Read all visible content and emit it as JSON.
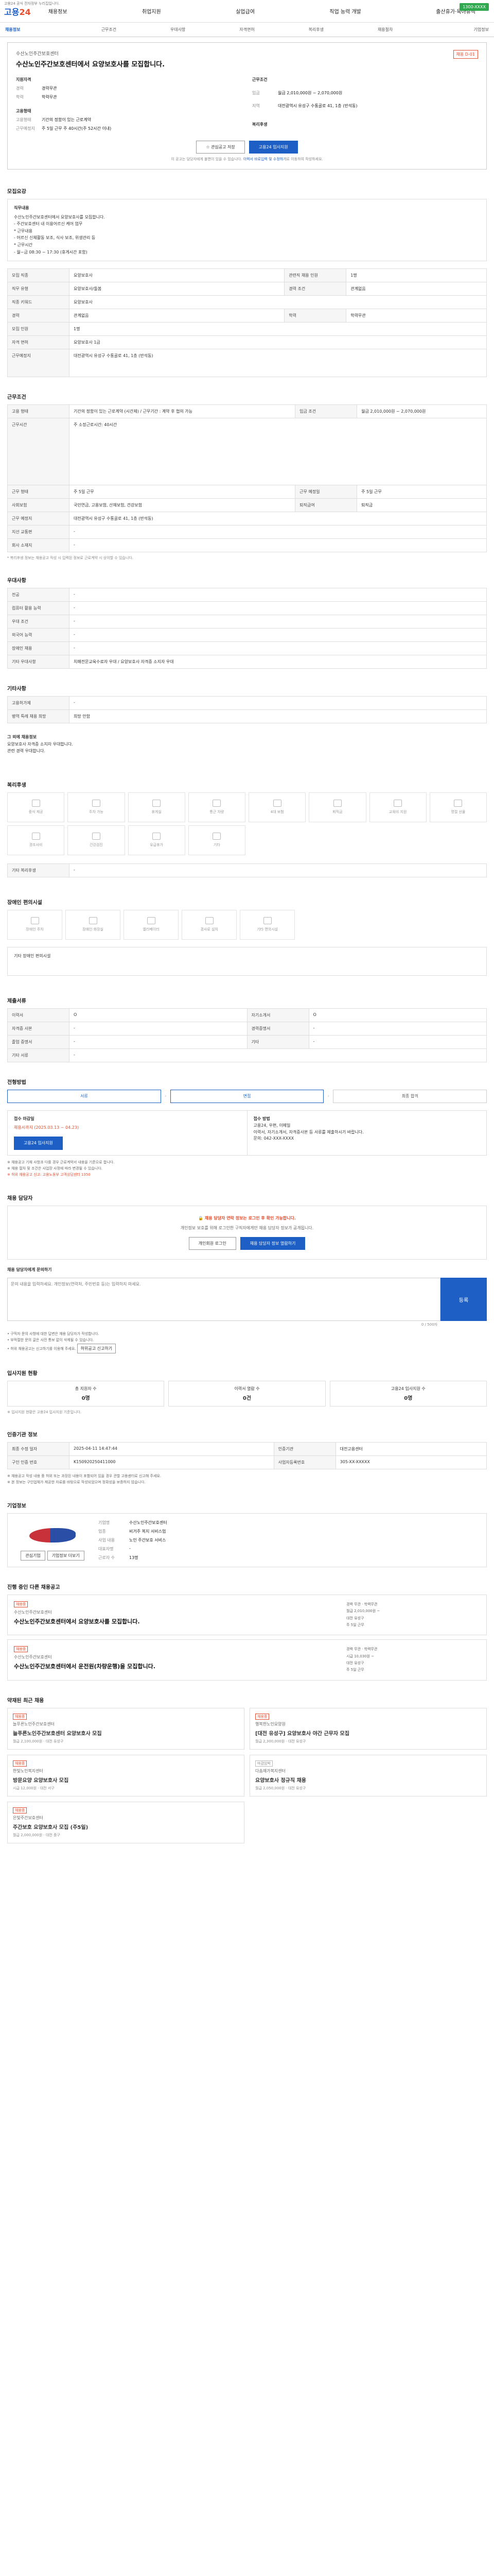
{
  "top": {
    "notice": "고용24 공식 전자정부 누리집입니다.",
    "logo_main": "고용",
    "logo_num": "24",
    "nav": [
      "채용정보",
      "취업지원",
      "실업급여",
      "직업 능력 개발",
      "출산휴가·육아휴직"
    ],
    "ad_btn": "1300-XXXX"
  },
  "tabs": [
    "채용정보",
    "근무조건",
    "우대사항",
    "자격면허",
    "복리후생",
    "채용절차",
    "기업정보"
  ],
  "head": {
    "org": "수산노인주간보호센터",
    "title": "수산노인주간보호센터에서 요양보호사를 모집합니다.",
    "badge": "채용 D-01",
    "left": [
      {
        "k": "지원자격",
        "v": ""
      },
      {
        "k": "경력",
        "v": "경력무관"
      },
      {
        "k": "학력",
        "v": "학력무관"
      },
      {
        "k": "고용형태",
        "v": ""
      },
      {
        "k": "고용형태",
        "v": "기간의 정함이 있는 근로계약"
      },
      {
        "k": "근무예정지",
        "v": "주 5일 근무 주 40시간(주 52시간 이내)"
      }
    ],
    "right": [
      {
        "k": "근무조건",
        "v": ""
      },
      {
        "k": "임금",
        "v": "월급 2,010,000원 ~ 2,070,000원"
      },
      {
        "k": "지역",
        "v": "대전광역시 유성구 수통골로 41, 1층 (반석동)"
      },
      {
        "k": "복리후생",
        "v": ""
      }
    ],
    "btn_scrap": "관심공고 저장",
    "btn_apply": "고용24 입사지원",
    "note_pre": "이 공고는 담당자에게 불편이 있을 수 있습니다.",
    "note_link": "이력서 바로입력 및 수정하기",
    "note_post": "로 이동하여 작성하세요."
  },
  "recruit": {
    "title": "모집요강",
    "job_label": "직무내용",
    "lines": [
      "수산노인주간보호센터에서 요양보호사를 모집합니다.",
      "- 주간보호센터 내 이용어르신 케어 업무",
      "* 근무내용",
      "- 어르신 신체활동 보조, 식사 보조, 위생관리 등",
      "* 근무시간",
      "- 월~금 08:30 ~ 17:30 (휴게시간 포함)"
    ],
    "rows": [
      {
        "k": "모집 직종",
        "v": "요양보호사",
        "k2": "관련직 채용 인원",
        "v2": "1명"
      },
      {
        "k": "직무 유형",
        "v": "요양보호사/돌봄",
        "k2": "경력 조건",
        "v2": "관계없음"
      },
      {
        "k": "직종 키워드",
        "v": "요양보호사",
        "k2": "",
        "v2": ""
      },
      {
        "k": "경력",
        "v": "관계없음",
        "k2": "학력",
        "v2": "학력무관"
      },
      {
        "k": "모집 인원",
        "v": "1명",
        "k2": "",
        "v2": ""
      },
      {
        "k": "자격 면허",
        "v": "요양보호사 1급",
        "k2": "",
        "v2": ""
      },
      {
        "k": "근무예정지",
        "v": "대전광역시 유성구 수통골로 41, 1층 (반석동)",
        "k2": "",
        "v2": ""
      }
    ]
  },
  "conditions": {
    "title": "근무조건",
    "rows": [
      {
        "k": "고용 형태",
        "v": "기간의 정함이 있는 근로계약 (시간제) / 근무기간 : 계약 후 협의 가능",
        "k2": "임금 조건",
        "v2": "월급 2,010,000원 ~ 2,070,000원"
      },
      {
        "k": "근무시간",
        "v": "주 소정근로시간: 40시간",
        "k2": "",
        "v2": ""
      },
      {
        "k": "근무 형태",
        "v": "주 5일 근무",
        "k2": "근무 예정일",
        "v2": "주 5일 근무"
      },
      {
        "k": "사회보험",
        "v": "국민연금, 고용보험, 산재보험, 건강보험",
        "k2": "퇴직급여",
        "v2": "퇴직금"
      },
      {
        "k": "근무 예정지",
        "v": "대전광역시 유성구 수통골로 41, 1층 (반석동)",
        "k2": "",
        "v2": ""
      },
      {
        "k": "지선 교통편",
        "v": "-",
        "k2": "",
        "v2": ""
      },
      {
        "k": "회사 소재지",
        "v": "-",
        "k2": "",
        "v2": ""
      }
    ],
    "note": "* 복리후생 정보는 채용공고 작성 시 입력된 정보로 근로계약 시 상이할 수 있습니다."
  },
  "prefer": {
    "title": "우대사항",
    "rows": [
      {
        "k": "전공",
        "v": "-"
      },
      {
        "k": "컴퓨터 활용 능력",
        "v": "-"
      },
      {
        "k": "우대 조건",
        "v": "-"
      },
      {
        "k": "외국어 능력",
        "v": "-"
      },
      {
        "k": "장애인 채용",
        "v": "-"
      },
      {
        "k": "기타 우대사항",
        "v": "치매전문교육수료자 우대 / 요양보호사 자격증 소지자 우대"
      }
    ]
  },
  "license": {
    "title": "기타사항",
    "rows": [
      {
        "k": "고용허가제",
        "v": "-"
      },
      {
        "k": "병역 특례 채용 희망",
        "v": "희망 안함"
      }
    ],
    "ext_title": "그 외에 채용정보",
    "ext_lines": [
      "요양보호사 자격증 소지자 우대합니다.",
      "관련 경력 우대합니다."
    ]
  },
  "welfare": {
    "title": "복리후생",
    "items": [
      "중식 제공",
      "주차 가능",
      "휴게실",
      "통근 차량",
      "4대 보험",
      "퇴직금",
      "교육비 지원",
      "명절 선물",
      "경조사비",
      "건강검진",
      "유급휴가",
      "기타"
    ],
    "extra_label": "기타 복리후생",
    "extra_value": "-"
  },
  "disab": {
    "title": "장애인 편의시설",
    "items": [
      "장애인 주차",
      "장애인 화장실",
      "엘리베이터",
      "경사로 설치",
      "기타 편의시설"
    ],
    "note": "기타 장애인 편의시설"
  },
  "docs": {
    "title": "제출서류",
    "rows": [
      {
        "k": "이력서",
        "v": "O",
        "k2": "자기소개서",
        "v2": "O"
      },
      {
        "k": "자격증 사본",
        "v": "-",
        "k2": "경력증명서",
        "v2": "-"
      },
      {
        "k": "졸업 증명서",
        "v": "-",
        "k2": "기타",
        "v2": "-"
      },
      {
        "k": "기타 서류",
        "v": "-",
        "k2": "",
        "v2": ""
      }
    ]
  },
  "procedure": {
    "title": "전형방법",
    "steps": [
      "서류",
      "면접",
      "최종 합격"
    ],
    "apply_title": "접수 마감일",
    "apply_date": "채용시까지 (2025.03.13 ~ 04.23)",
    "apply_btn": "고용24 입사지원",
    "method_title": "접수 방법",
    "method_lines": [
      "고용24, 우편, 이메일",
      "이력서, 자기소개서, 자격증사본 등 서류를 제출하시기 바랍니다.",
      "문의: 042-XXX-XXXX"
    ],
    "notes": [
      "※ 채용공고 기재 사항과 다를 경우 근로계약서 내용을 기준으로 합니다.",
      "※ 채용 절차 및 조건은 사업장 사정에 따라 변경될 수 있습니다.",
      "※ 허위 채용공고 신고: 고용노동부 고객상담센터 1350"
    ]
  },
  "contact": {
    "title": "채용 담당자",
    "warn": "채용 담당자 연락 정보는 로그인 후 확인 가능합니다.",
    "desc": "개인정보 보호를 위해 로그인한 구직자에게만 채용 담당자 정보가 공개됩니다.",
    "btn_login": "개인회원 로그인",
    "btn_info": "채용 담당자 정보 열람하기",
    "qa_title": "채용 담당자에게 문의하기",
    "qa_placeholder": "문의 내용을 입력하세요. 개인정보(연락처, 주민번호 등)는 입력하지 마세요.",
    "qa_count": "0 / 500자",
    "qa_send": "등록",
    "bullets": [
      "• 구직자 문의 사항에 대한 답변은 채용 담당자가 작성합니다.",
      "• 부적절한 문의 글은 사전 통보 없이 삭제될 수 있습니다.",
      "• 허위 채용공고는 신고하기를 이용해 주세요."
    ],
    "report_btn": "허위공고 신고하기"
  },
  "stats": {
    "title": "입사지원 현황",
    "items": [
      {
        "label": "총 지원자 수",
        "n": "0명"
      },
      {
        "label": "이력서 열람 수",
        "n": "0건"
      },
      {
        "label": "고용24 입사지원 수",
        "n": "0명"
      }
    ],
    "note": "※ 입사지원 현황은 고용24 입사지원 기준입니다."
  },
  "info": {
    "title": "인증기관 정보",
    "rows": [
      {
        "k": "최종 수정 일자",
        "v": "2025-04-11 14:47:44",
        "k2": "인증기관",
        "v2": "대전고용센터"
      },
      {
        "k": "구인 인증 번호",
        "v": "K150920250411000",
        "k2": "사업자등록번호",
        "v2": "305-XX-XXXXX"
      }
    ],
    "notes": [
      "※ 채용공고 작성 내용 중 허위 또는 과장된 내용이 포함되어 있을 경우 관할 고용센터로 신고해 주세요.",
      "※ 본 정보는 구인업체가 제공한 자료를 바탕으로 작성되었으며 정확성을 보증하지 않습니다."
    ]
  },
  "company": {
    "title": "기업정보",
    "btn_follow": "관심기업",
    "btn_more": "기업정보 더보기",
    "kv": [
      {
        "k": "기업명",
        "v": "수산노인주간보호센터"
      },
      {
        "k": "업종",
        "v": "비거주 복지 서비스업"
      },
      {
        "k": "사업 내용",
        "v": "노인 주간보호 서비스"
      },
      {
        "k": "대표자명",
        "v": "-"
      },
      {
        "k": "근로자 수",
        "v": "13명"
      }
    ]
  },
  "other_jobs": {
    "title": "진행 중인 다른 채용공고",
    "jobs": [
      {
        "tag": "채용중",
        "org": "수산노인주간보호센터",
        "title": "수산노인주간보호센터에서 요양보호사를 모집합니다.",
        "meta": [
          "경력 무관 · 학력무관",
          "월급 2,010,000원 ~",
          "대전 유성구",
          "주 5일 근무"
        ]
      },
      {
        "tag": "채용중",
        "org": "수산노인주간보호센터",
        "title": "수산노인주간보호센터에서 운전원(차량운행)을 모집합니다.",
        "meta": [
          "경력 무관 · 학력무관",
          "시급 10,030원 ~",
          "대전 유성구",
          "주 5일 근무"
        ]
      }
    ]
  },
  "recent": {
    "title": "약재된 최근 채용",
    "cards": [
      {
        "tag": "채용중",
        "org": "늘푸른노인주간보호센터",
        "title": "늘푸른노인주간보호센터 요양보호사 모집",
        "meta": "월급 2,100,000원 · 대전 유성구"
      },
      {
        "tag": "채용중",
        "org": "행복한노인요양원",
        "title": "[대전 유성구] 요양보호사 야간 근무자 모집",
        "meta": "월급 2,300,000원 · 대전 유성구"
      },
      {
        "tag": "채용중",
        "org": "한빛노인복지센터",
        "title": "방문요양 요양보호사 모집",
        "meta": "시급 12,000원 · 대전 서구"
      },
      {
        "tag": "마감임박",
        "org": "다솜재가복지센터",
        "title": "요양보호사 정규직 채용",
        "meta": "월급 2,050,000원 · 대전 유성구"
      },
      {
        "tag": "채용중",
        "org": "은빛주간보호센터",
        "title": "주간보호 요양보호사 모집 (주5일)",
        "meta": "월급 2,000,000원 · 대전 중구"
      }
    ]
  }
}
